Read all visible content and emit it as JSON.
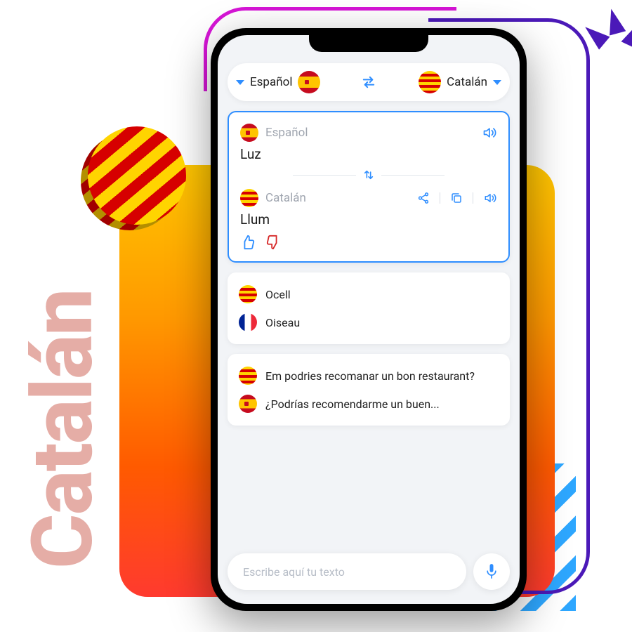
{
  "bg_text": "Catalán",
  "lang_bar": {
    "source_label": "Español",
    "target_label": "Catalán"
  },
  "active_card": {
    "source_lang": "Español",
    "source_text": "Luz",
    "target_lang": "Catalán",
    "target_text": "Llum"
  },
  "history": [
    {
      "top_text": "Ocell",
      "bottom_text": "Oiseau"
    },
    {
      "top_text": "Em podries recomanar un bon restaurant?",
      "bottom_text": "¿Podrías recomendarme un buen..."
    }
  ],
  "input": {
    "placeholder": "Escribe aquí tu texto"
  }
}
